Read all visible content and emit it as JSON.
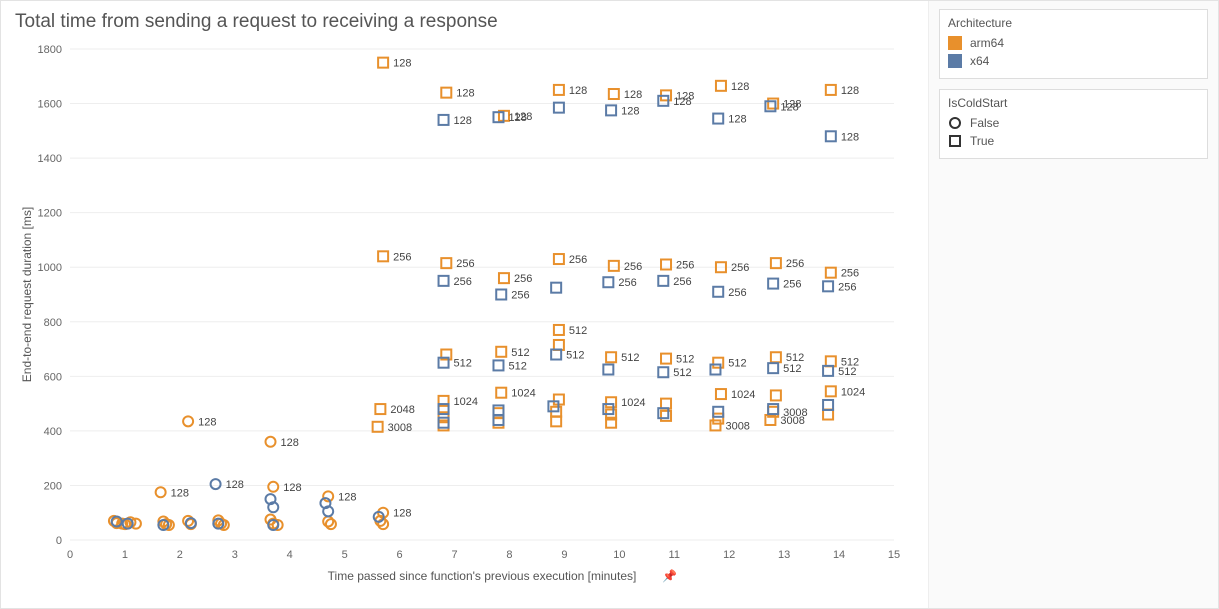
{
  "title": "Total time from sending a request to receiving a response",
  "xlabel": "Time passed since function's previous execution [minutes]",
  "ylabel": "End-to-end request duration [ms]",
  "legend_arch": {
    "title": "Architecture",
    "items": [
      {
        "name": "arm64",
        "color": "#e8902c"
      },
      {
        "name": "x64",
        "color": "#5b7ba6"
      }
    ]
  },
  "legend_cold": {
    "title": "IsColdStart",
    "items": [
      {
        "name": "False",
        "shape": "circle"
      },
      {
        "name": "True",
        "shape": "square"
      }
    ]
  },
  "chart_data": {
    "type": "scatter",
    "xlim": [
      0,
      15
    ],
    "ylim": [
      0,
      1800
    ],
    "xticks": [
      0,
      1,
      2,
      3,
      4,
      5,
      6,
      7,
      8,
      9,
      10,
      11,
      12,
      13,
      14,
      15
    ],
    "yticks": [
      0,
      200,
      400,
      600,
      800,
      1000,
      1200,
      1400,
      1600,
      1800
    ],
    "series": {
      "arm64_cold": {
        "arch": "arm64",
        "cold": true,
        "color": "#e8902c",
        "shape": "square",
        "points": [
          {
            "x": 5.7,
            "y": 1750,
            "label": "128"
          },
          {
            "x": 6.85,
            "y": 1640,
            "label": "128"
          },
          {
            "x": 7.9,
            "y": 1555,
            "label": "128"
          },
          {
            "x": 8.9,
            "y": 1650,
            "label": "128"
          },
          {
            "x": 9.9,
            "y": 1635,
            "label": "128"
          },
          {
            "x": 10.85,
            "y": 1630,
            "label": "128"
          },
          {
            "x": 11.85,
            "y": 1665,
            "label": "128"
          },
          {
            "x": 12.8,
            "y": 1600,
            "label": "128"
          },
          {
            "x": 13.85,
            "y": 1650,
            "label": "128"
          },
          {
            "x": 5.7,
            "y": 1040,
            "label": "256"
          },
          {
            "x": 6.85,
            "y": 1015,
            "label": "256"
          },
          {
            "x": 7.9,
            "y": 960,
            "label": "256"
          },
          {
            "x": 8.9,
            "y": 1030,
            "label": "256"
          },
          {
            "x": 9.9,
            "y": 1005,
            "label": "256"
          },
          {
            "x": 10.85,
            "y": 1010,
            "label": "256"
          },
          {
            "x": 11.85,
            "y": 1000,
            "label": "256"
          },
          {
            "x": 12.85,
            "y": 1015,
            "label": "256"
          },
          {
            "x": 13.85,
            "y": 980,
            "label": "256"
          },
          {
            "x": 8.9,
            "y": 770,
            "label": "512"
          },
          {
            "x": 6.85,
            "y": 680,
            "label": ""
          },
          {
            "x": 7.85,
            "y": 690,
            "label": "512"
          },
          {
            "x": 8.9,
            "y": 715,
            "label": ""
          },
          {
            "x": 9.85,
            "y": 670,
            "label": "512"
          },
          {
            "x": 10.85,
            "y": 665,
            "label": "512"
          },
          {
            "x": 11.8,
            "y": 650,
            "label": "512"
          },
          {
            "x": 12.85,
            "y": 670,
            "label": "512"
          },
          {
            "x": 13.85,
            "y": 655,
            "label": "512"
          },
          {
            "x": 7.85,
            "y": 540,
            "label": "1024"
          },
          {
            "x": 6.8,
            "y": 510,
            "label": "1024"
          },
          {
            "x": 8.9,
            "y": 515,
            "label": ""
          },
          {
            "x": 9.85,
            "y": 505,
            "label": "1024"
          },
          {
            "x": 10.85,
            "y": 500,
            "label": ""
          },
          {
            "x": 11.85,
            "y": 535,
            "label": "1024"
          },
          {
            "x": 12.85,
            "y": 530,
            "label": ""
          },
          {
            "x": 13.85,
            "y": 545,
            "label": "1024"
          },
          {
            "x": 5.65,
            "y": 480,
            "label": "2048"
          },
          {
            "x": 6.8,
            "y": 450,
            "label": ""
          },
          {
            "x": 7.8,
            "y": 465,
            "label": ""
          },
          {
            "x": 8.85,
            "y": 470,
            "label": ""
          },
          {
            "x": 9.85,
            "y": 460,
            "label": ""
          },
          {
            "x": 10.85,
            "y": 455,
            "label": ""
          },
          {
            "x": 11.8,
            "y": 445,
            "label": ""
          },
          {
            "x": 12.8,
            "y": 470,
            "label": "3008"
          },
          {
            "x": 13.8,
            "y": 460,
            "label": ""
          },
          {
            "x": 5.6,
            "y": 415,
            "label": "3008"
          },
          {
            "x": 6.8,
            "y": 420,
            "label": ""
          },
          {
            "x": 7.8,
            "y": 430,
            "label": ""
          },
          {
            "x": 8.85,
            "y": 435,
            "label": ""
          },
          {
            "x": 9.85,
            "y": 430,
            "label": ""
          },
          {
            "x": 11.75,
            "y": 420,
            "label": "3008"
          },
          {
            "x": 12.75,
            "y": 440,
            "label": "3008"
          }
        ]
      },
      "x64_cold": {
        "arch": "x64",
        "cold": true,
        "color": "#5b7ba6",
        "shape": "square",
        "points": [
          {
            "x": 6.8,
            "y": 1540,
            "label": "128"
          },
          {
            "x": 7.8,
            "y": 1550,
            "label": "128"
          },
          {
            "x": 8.9,
            "y": 1585,
            "label": ""
          },
          {
            "x": 9.85,
            "y": 1575,
            "label": "128"
          },
          {
            "x": 10.8,
            "y": 1610,
            "label": "128"
          },
          {
            "x": 11.8,
            "y": 1545,
            "label": "128"
          },
          {
            "x": 12.75,
            "y": 1590,
            "label": "128"
          },
          {
            "x": 13.85,
            "y": 1480,
            "label": "128"
          },
          {
            "x": 6.8,
            "y": 950,
            "label": "256"
          },
          {
            "x": 7.85,
            "y": 900,
            "label": "256"
          },
          {
            "x": 8.85,
            "y": 925,
            "label": ""
          },
          {
            "x": 9.8,
            "y": 945,
            "label": "256"
          },
          {
            "x": 10.8,
            "y": 950,
            "label": "256"
          },
          {
            "x": 11.8,
            "y": 910,
            "label": "256"
          },
          {
            "x": 12.8,
            "y": 940,
            "label": "256"
          },
          {
            "x": 13.8,
            "y": 930,
            "label": "256"
          },
          {
            "x": 6.8,
            "y": 650,
            "label": "512"
          },
          {
            "x": 7.8,
            "y": 640,
            "label": "512"
          },
          {
            "x": 8.85,
            "y": 680,
            "label": "512"
          },
          {
            "x": 9.8,
            "y": 625,
            "label": ""
          },
          {
            "x": 10.8,
            "y": 615,
            "label": "512"
          },
          {
            "x": 11.75,
            "y": 625,
            "label": ""
          },
          {
            "x": 12.8,
            "y": 630,
            "label": "512"
          },
          {
            "x": 13.8,
            "y": 620,
            "label": "512"
          },
          {
            "x": 6.8,
            "y": 480,
            "label": ""
          },
          {
            "x": 7.8,
            "y": 475,
            "label": ""
          },
          {
            "x": 8.8,
            "y": 490,
            "label": ""
          },
          {
            "x": 9.8,
            "y": 480,
            "label": ""
          },
          {
            "x": 10.8,
            "y": 465,
            "label": ""
          },
          {
            "x": 11.8,
            "y": 470,
            "label": ""
          },
          {
            "x": 12.8,
            "y": 480,
            "label": ""
          },
          {
            "x": 13.8,
            "y": 495,
            "label": ""
          },
          {
            "x": 6.8,
            "y": 430,
            "label": ""
          },
          {
            "x": 7.8,
            "y": 440,
            "label": ""
          }
        ]
      },
      "arm64_warm": {
        "arch": "arm64",
        "cold": false,
        "color": "#e8902c",
        "shape": "circle",
        "points": [
          {
            "x": 2.15,
            "y": 435,
            "label": "128"
          },
          {
            "x": 3.65,
            "y": 360,
            "label": "128"
          },
          {
            "x": 1.65,
            "y": 175,
            "label": "128"
          },
          {
            "x": 3.7,
            "y": 195,
            "label": "128"
          },
          {
            "x": 4.7,
            "y": 160,
            "label": "128"
          },
          {
            "x": 5.7,
            "y": 100,
            "label": "128"
          },
          {
            "x": 0.8,
            "y": 70,
            "label": ""
          },
          {
            "x": 0.85,
            "y": 62,
            "label": ""
          },
          {
            "x": 0.95,
            "y": 60,
            "label": ""
          },
          {
            "x": 1.0,
            "y": 58,
            "label": ""
          },
          {
            "x": 1.1,
            "y": 65,
            "label": ""
          },
          {
            "x": 1.2,
            "y": 60,
            "label": ""
          },
          {
            "x": 1.7,
            "y": 68,
            "label": ""
          },
          {
            "x": 1.75,
            "y": 58,
            "label": ""
          },
          {
            "x": 1.8,
            "y": 55,
            "label": ""
          },
          {
            "x": 2.15,
            "y": 70,
            "label": ""
          },
          {
            "x": 2.2,
            "y": 58,
            "label": ""
          },
          {
            "x": 2.7,
            "y": 72,
            "label": ""
          },
          {
            "x": 2.75,
            "y": 60,
            "label": ""
          },
          {
            "x": 2.8,
            "y": 55,
            "label": ""
          },
          {
            "x": 3.65,
            "y": 75,
            "label": ""
          },
          {
            "x": 3.7,
            "y": 60,
            "label": ""
          },
          {
            "x": 3.78,
            "y": 55,
            "label": ""
          },
          {
            "x": 4.7,
            "y": 68,
            "label": ""
          },
          {
            "x": 4.75,
            "y": 58,
            "label": ""
          },
          {
            "x": 5.65,
            "y": 70,
            "label": ""
          },
          {
            "x": 5.7,
            "y": 58,
            "label": ""
          }
        ]
      },
      "x64_warm": {
        "arch": "x64",
        "cold": false,
        "color": "#5b7ba6",
        "shape": "circle",
        "points": [
          {
            "x": 2.65,
            "y": 205,
            "label": "128"
          },
          {
            "x": 3.65,
            "y": 150,
            "label": ""
          },
          {
            "x": 3.7,
            "y": 120,
            "label": ""
          },
          {
            "x": 4.65,
            "y": 135,
            "label": ""
          },
          {
            "x": 4.7,
            "y": 105,
            "label": ""
          },
          {
            "x": 5.62,
            "y": 85,
            "label": ""
          },
          {
            "x": 0.85,
            "y": 68,
            "label": ""
          },
          {
            "x": 1.05,
            "y": 60,
            "label": ""
          },
          {
            "x": 1.7,
            "y": 55,
            "label": ""
          },
          {
            "x": 2.2,
            "y": 62,
            "label": ""
          },
          {
            "x": 2.7,
            "y": 60,
            "label": ""
          },
          {
            "x": 3.7,
            "y": 55,
            "label": ""
          }
        ]
      }
    }
  }
}
